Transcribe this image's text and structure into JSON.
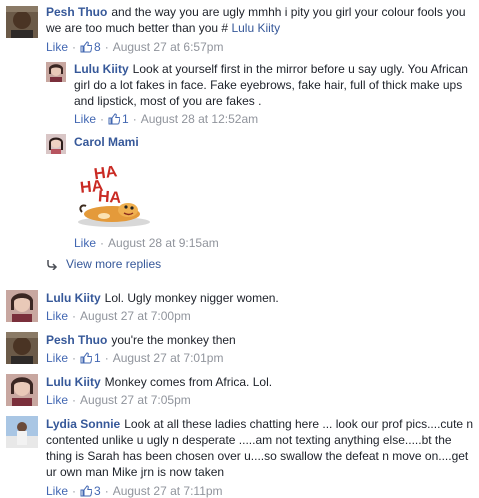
{
  "comments": [
    {
      "author": "Pesh Thuo",
      "text": "and the way you are ugly mmhh i pity you girl your colour fools you we are too much better than you #",
      "mention": "Lulu Kiity",
      "like_label": "Like",
      "like_count": "8",
      "timestamp": "August 27 at 6:57pm"
    },
    {
      "author": "Lulu Kiity",
      "text": "Look at yourself first in the mirror before u say ugly. You African girl do a lot fakes in face. Fake eyebrows, fake hair, full of thick make ups and lipstick, most of you are fakes .",
      "like_label": "Like",
      "like_count": "1",
      "timestamp": "August 28 at 12:52am"
    },
    {
      "author": "Carol Mami",
      "sticker_text": "HA HA HA",
      "like_label": "Like",
      "timestamp": "August 28 at 9:15am"
    },
    {
      "view_more_label": "View more replies"
    },
    {
      "author": "Lulu Kiity",
      "text": "Lol. Ugly monkey nigger women.",
      "like_label": "Like",
      "timestamp": "August 27 at 7:00pm"
    },
    {
      "author": "Pesh Thuo",
      "text": "you're the monkey then",
      "like_label": "Like",
      "like_count": "1",
      "timestamp": "August 27 at 7:01pm"
    },
    {
      "author": "Lulu Kiity",
      "text": "Monkey comes from Africa. Lol.",
      "like_label": "Like",
      "timestamp": "August 27 at 7:05pm"
    },
    {
      "author": "Lydia Sonnie",
      "text": "Look at all these ladies chatting here ... look our prof pics....cute n contented unlike u ugly n desperate .....am not texting anything else.....bt the thing is Sarah has been chosen over u....so swallow the defeat n move on....get ur own man Mike jrn is now taken",
      "like_label": "Like",
      "like_count": "3",
      "timestamp": "August 27 at 7:11pm"
    }
  ],
  "colors": {
    "link": "#365899",
    "like": "#4267b2",
    "meta": "#90949c",
    "text": "#1d2129"
  }
}
